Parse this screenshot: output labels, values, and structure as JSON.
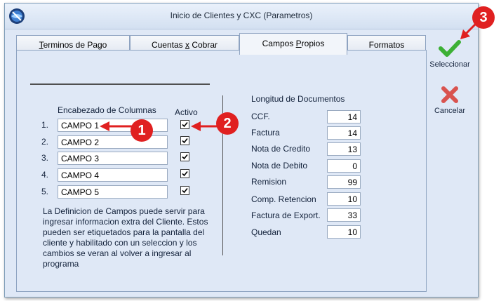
{
  "window": {
    "title": "Inicio de Clientes y CXC (Parametros)"
  },
  "tabs": [
    {
      "pre": "",
      "ul": "T",
      "post": "erminos de Pago"
    },
    {
      "pre": "Cuentas ",
      "ul": "x",
      "post": " Cobrar"
    },
    {
      "pre": "Campos ",
      "ul": "P",
      "post": "ropios"
    },
    {
      "pre": "Formatos",
      "ul": "",
      "post": ""
    }
  ],
  "columns": {
    "header": "Encabezado de Columnas",
    "active_header": "Activo",
    "rows": [
      {
        "num": "1.",
        "value": "CAMPO 1",
        "active": true
      },
      {
        "num": "2.",
        "value": "CAMPO 2",
        "active": true
      },
      {
        "num": "3.",
        "value": "CAMPO 3",
        "active": true
      },
      {
        "num": "4.",
        "value": "CAMPO 4",
        "active": true
      },
      {
        "num": "5.",
        "value": "CAMPO 5",
        "active": true
      }
    ],
    "description": "La Definicion de Campos puede servir para ingresar informacion extra del Cliente. Estos pueden ser etiquetados para la pantalla del cliente y habilitado con un seleccion  y los cambios se veran al volver a ingresar al programa"
  },
  "lengths": {
    "header": "Longitud de Documentos",
    "rows": [
      {
        "label": "CCF.",
        "value": "14"
      },
      {
        "label": "Factura",
        "value": "14"
      },
      {
        "label": "Nota de Credito",
        "value": "13"
      },
      {
        "label": "Nota de Debito",
        "value": "0"
      },
      {
        "label": "Remision",
        "value": "99"
      },
      {
        "label": "Comp. Retencion",
        "value": "10"
      },
      {
        "label": "Factura de Export.",
        "value": "33"
      },
      {
        "label": "Quedan",
        "value": "10"
      }
    ]
  },
  "actions": {
    "select_label": "Seleccionar",
    "cancel_label": "Cancelar"
  },
  "callouts": [
    "1",
    "2",
    "3"
  ],
  "colors": {
    "accent_red": "#e02020",
    "ok_green": "#3cb035",
    "cancel_red": "#d9534f",
    "window_bg": "#dfe8f6"
  }
}
